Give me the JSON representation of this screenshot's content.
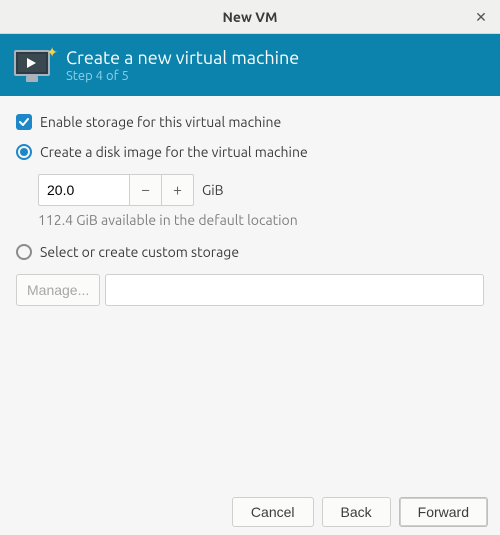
{
  "window": {
    "title": "New VM"
  },
  "banner": {
    "title": "Create a new virtual machine",
    "step": "Step 4 of 5"
  },
  "storage": {
    "enable_label": "Enable storage for this virtual machine",
    "enable_checked": true,
    "create_label": "Create a disk image for the virtual machine",
    "create_selected": true,
    "size_value": "20.0",
    "size_unit": "GiB",
    "available_hint": "112.4 GiB available in the default location",
    "custom_label": "Select or create custom storage",
    "custom_selected": false,
    "manage_label": "Manage...",
    "path_value": ""
  },
  "footer": {
    "cancel": "Cancel",
    "back": "Back",
    "forward": "Forward"
  }
}
